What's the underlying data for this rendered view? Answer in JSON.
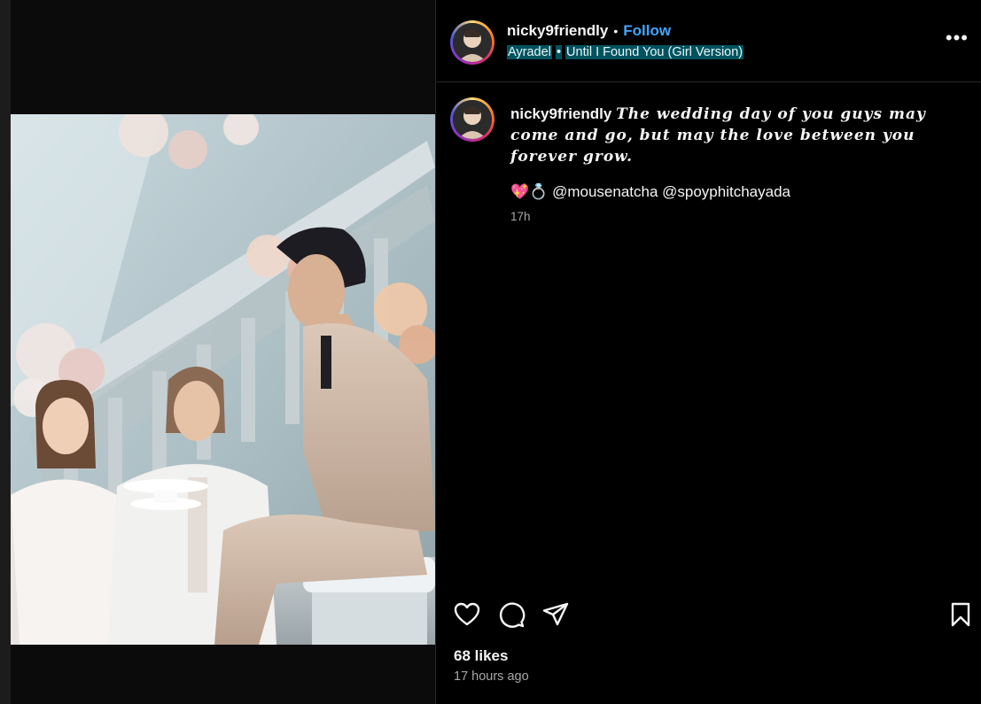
{
  "post": {
    "username": "nicky9friendly",
    "follow_label": "Follow",
    "separator": "•",
    "music_artist": "Ayradel",
    "music_title": "Until I Found You (Girl Version)",
    "more_label": "•••",
    "caption_username": "nicky9friendly",
    "caption_text": "The wedding day of you guys may come and go, but may the love between you forever grow.",
    "tag_emoji": "💖💍",
    "tags": "@mousenatcha @spoyphitchayada",
    "caption_time": "17h",
    "likes": "68 likes",
    "posted_ago": "17 hours ago"
  },
  "icons": {
    "like": "heart-icon",
    "comment": "comment-icon",
    "share": "share-icon",
    "save": "bookmark-icon",
    "more": "more-horizontal-icon"
  },
  "colors": {
    "background": "#000000",
    "follow": "#3ea6ff",
    "music_highlight": "#00535e",
    "secondary_text": "#a8a8a8"
  }
}
